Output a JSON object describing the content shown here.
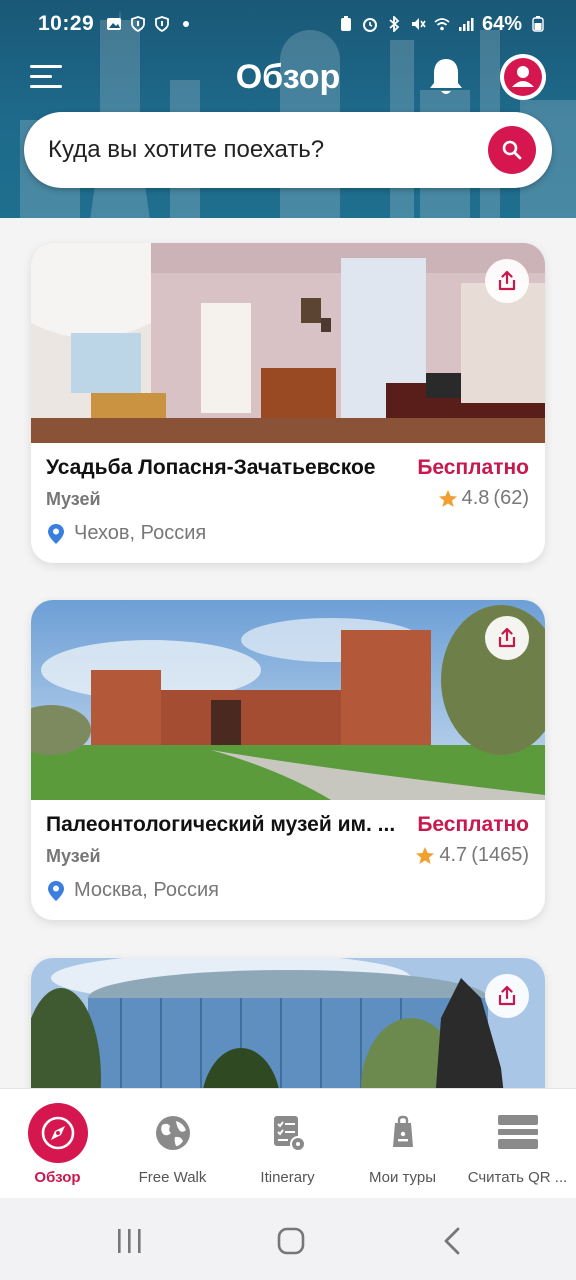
{
  "status_bar": {
    "time": "10:29",
    "battery": "64%"
  },
  "header": {
    "title": "Обзор"
  },
  "search": {
    "placeholder": "Куда вы хотите поехать?"
  },
  "cards": [
    {
      "title": "Усадьба Лопасня-Зачатьевское",
      "price": "Бесплатно",
      "type": "Музей",
      "rating": "4.8",
      "reviews": "(62)",
      "location": "Чехов, Россия"
    },
    {
      "title": "Палеонтологический музей им. ...",
      "price": "Бесплатно",
      "type": "Музей",
      "rating": "4.7",
      "reviews": "(1465)",
      "location": "Москва, Россия"
    },
    {
      "title": "",
      "price": "",
      "type": "",
      "rating": "",
      "reviews": "",
      "location": ""
    }
  ],
  "bottom_nav": {
    "items": [
      {
        "label": "Обзор",
        "icon": "compass-icon",
        "active": true
      },
      {
        "label": "Free Walk",
        "icon": "globe-icon",
        "active": false
      },
      {
        "label": "Itinerary",
        "icon": "checklist-icon",
        "active": false
      },
      {
        "label": "Мои туры",
        "icon": "bag-icon",
        "active": false
      },
      {
        "label": "Считать QR ...",
        "icon": "qr-scan-icon",
        "active": false
      }
    ]
  },
  "colors": {
    "header_bg": "#1e6a8b",
    "accent": "#d6164f",
    "price": "#c8184e",
    "star": "#f0a030",
    "pin": "#3a7ee0"
  }
}
